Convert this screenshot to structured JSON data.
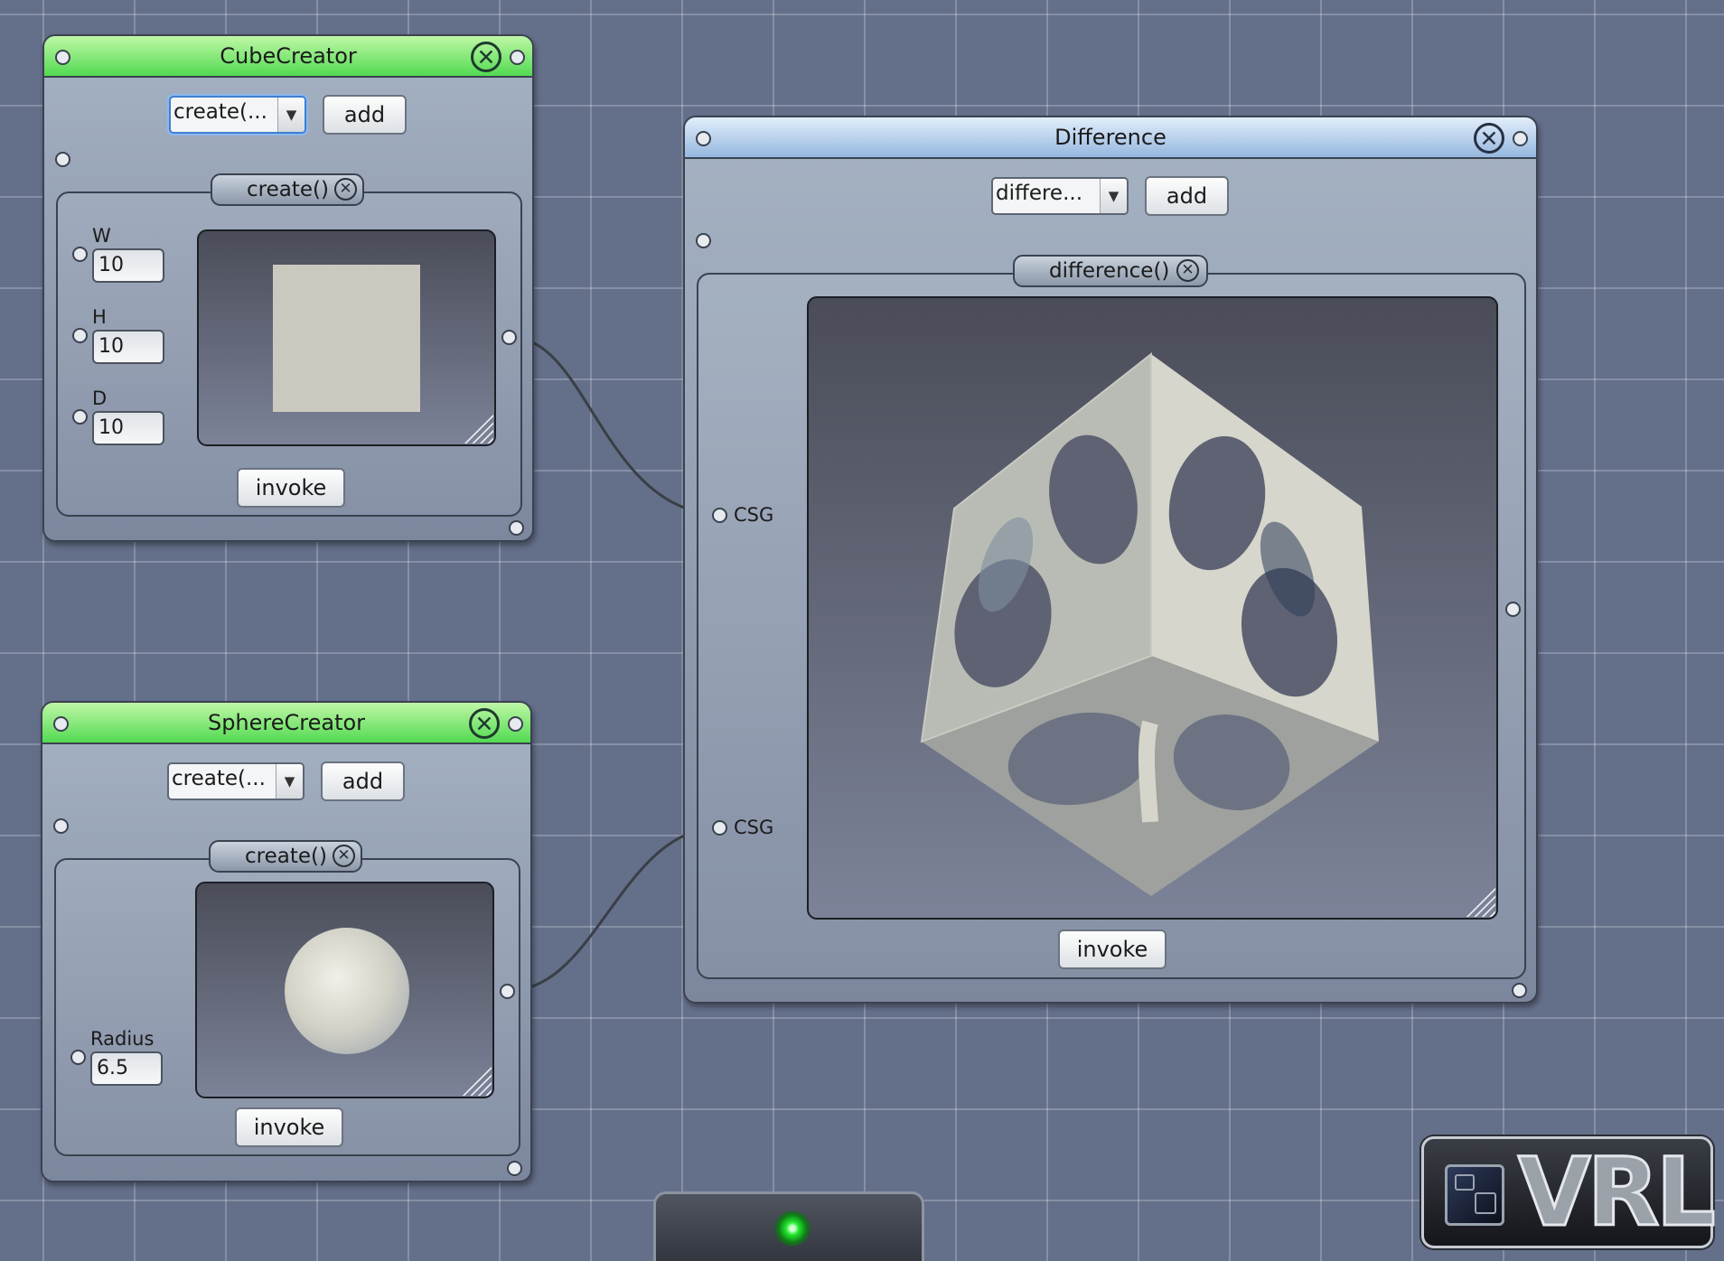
{
  "canvas": {
    "background_color": "#646f8a",
    "grid_color": "#b9c0cd"
  },
  "cube_creator": {
    "title": "CubeCreator",
    "method_combo": "create(...",
    "add_label": "add",
    "method_tab": "create()",
    "params": [
      {
        "label": "W",
        "value": "10"
      },
      {
        "label": "H",
        "value": "10"
      },
      {
        "label": "D",
        "value": "10"
      }
    ],
    "invoke_label": "invoke"
  },
  "sphere_creator": {
    "title": "SphereCreator",
    "method_combo": "create(...",
    "add_label": "add",
    "method_tab": "create()",
    "params": [
      {
        "label": "Radius",
        "value": "6.5"
      }
    ],
    "invoke_label": "invoke"
  },
  "difference": {
    "title": "Difference",
    "method_combo": "differe...",
    "add_label": "add",
    "method_tab": "difference()",
    "inputs": [
      {
        "label": "CSG"
      },
      {
        "label": "CSG"
      }
    ],
    "invoke_label": "invoke"
  },
  "logo": {
    "text": "VRL"
  },
  "colors": {
    "title_green": "#52da52",
    "title_blue": "#95b7df",
    "status_led": "#21e82c"
  },
  "icons": [
    "close-icon",
    "dropdown-arrow-icon",
    "resize-grip-icon",
    "vrl-logo-icon",
    "status-led-icon"
  ]
}
